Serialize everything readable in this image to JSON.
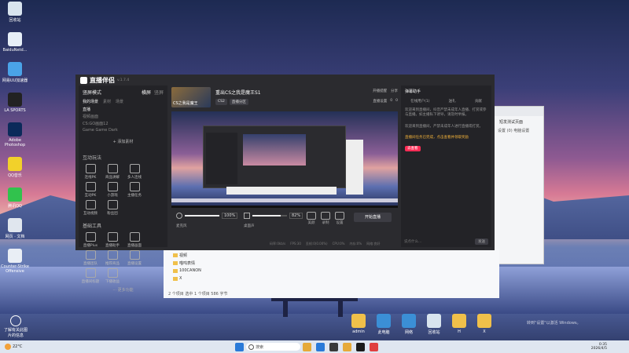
{
  "desktop": {
    "icons_left": [
      {
        "label": "回收站",
        "color": "#d8e4ee"
      },
      {
        "label": "BaiduNetd...",
        "color": "#e6eef7"
      },
      {
        "label": "网易UU加速器",
        "color": "#4aa3e8"
      },
      {
        "label": "LA SPORTS",
        "color": "#222222"
      },
      {
        "label": "Adobe Photoshop",
        "color": "#0b2a5a"
      },
      {
        "label": "QQ音乐",
        "color": "#f2d12a"
      },
      {
        "label": "腾讯QQ",
        "color": "#31c24d"
      },
      {
        "label": "网页 · 文档",
        "color": "#e0e6ee"
      },
      {
        "label": "Counter-Strike Offensive",
        "color": "#e9eef5"
      }
    ],
    "bottom_left_label": "了解有关此图片的信息",
    "icons_bottom": [
      {
        "label": "admin",
        "color": "#f0c04a"
      },
      {
        "label": "此电脑",
        "color": "#3b8fd6"
      },
      {
        "label": "网络",
        "color": "#3b8fd6"
      },
      {
        "label": "回收站",
        "color": "#d8e4ee"
      },
      {
        "label": "H",
        "color": "#f0c04a"
      },
      {
        "label": "X",
        "color": "#f0c04a"
      }
    ],
    "activation_text": "转到\"设置\"以激活 Windows。"
  },
  "taskbar": {
    "weather": "22°C",
    "search_placeholder": "搜索",
    "time": "0:35",
    "date": "2026/4/5"
  },
  "explorer": {
    "items": [
      "视频",
      "喵呜表情",
      "100CANON",
      "X"
    ],
    "status": "2 个项目  选中 1 个项目  586 字节"
  },
  "right_window": {
    "title": "短发测试页面",
    "line": "设置 (0)  电脑设置"
  },
  "app": {
    "title": "直播伴侣",
    "version": "v.1.7.4",
    "scene_mode": "竖屏模式",
    "scene_mode_right": [
      "横屏",
      "竖屏"
    ],
    "scene_tabs": [
      "我的场景",
      "素材",
      "场景"
    ],
    "sources": [
      "直播",
      "视频画面",
      "CS:GO画面12",
      "Game Game Dark"
    ],
    "add_source": "+ 添加素材",
    "interactive_title": "互动玩法",
    "interactive": [
      "连线PK",
      "商品讲解",
      "多人连线",
      "互动PK",
      "小游戏",
      "主播任务",
      "互动视频",
      "粉丝团"
    ],
    "basic_title": "基础工具",
    "basic": [
      "直播Plus",
      "直播助手",
      "直播画面",
      "直播团队",
      "推荐商品",
      "直播设置",
      "直播间标题",
      "下播收益"
    ],
    "more": "··· 更多功能",
    "stream_title": "重出CS之我是魔王S1",
    "stream_thumb_text": "CS之我是魔王",
    "category": "CS2",
    "category_tag": "直播分区",
    "top_actions": [
      "开播提醒",
      "分享",
      "直播设置",
      "分享"
    ],
    "preview_badges": [
      "全部分区",
      "0",
      "0",
      "0"
    ],
    "volume1_label": "麦克风",
    "volume1_value": "100%",
    "volume2_label": "桌面声",
    "volume2_value": "82%",
    "controls": [
      "美颜",
      "录制",
      "设置"
    ],
    "start_button": "开始直播",
    "status_bar": [
      "码率:0kb/s",
      "FPS:30",
      "丢帧:0(0.00%)",
      "CPU:0%",
      "内存:0%",
      "网络:良好"
    ]
  },
  "panel": {
    "top_tab": "直播助手",
    "header": "弹幕助手",
    "tabs": [
      "在线用户(1)",
      "送礼",
      "贡献"
    ],
    "messages": [
      "欢迎来到直播间，抖音严禁未成年人直播、打赏或参与直播。如主播私下诱导，请及时举报。",
      "欢迎来到直播间，严禁未成年人进行直播或打赏。",
      "直播间任务已完成，点击查看并领取奖励"
    ],
    "yellow_notice": "直播间任务提示",
    "orange_link": "去查看",
    "side_labels": [
      "接入设置",
      "开播提醒",
      "清屏"
    ],
    "input_placeholder": "说点什么...",
    "send_button": "发送"
  },
  "colors": {
    "app_bg": "#2b2b2f",
    "left_bg": "#232327",
    "accent": "#fe2c55",
    "notice": "#f3b23a"
  }
}
